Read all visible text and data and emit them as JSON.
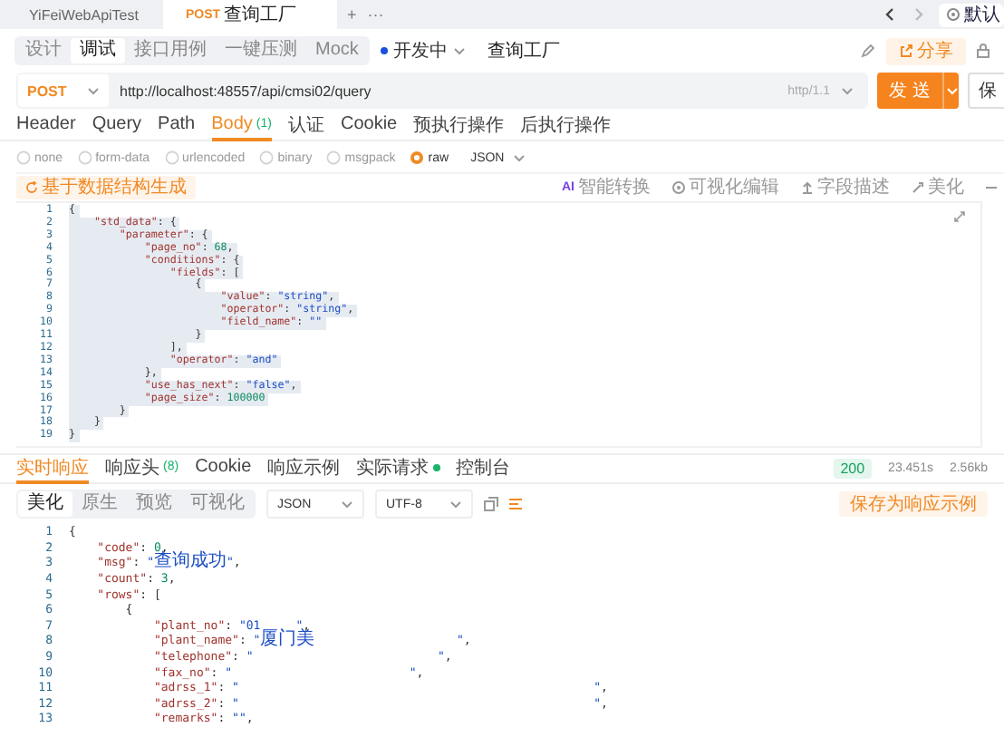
{
  "app_tabs": [
    {
      "label": "YiFeiWebApiTest",
      "selected": false
    },
    {
      "method": "POST",
      "label": "查询工厂",
      "selected": true
    }
  ],
  "app_tab_actions": [
    "+",
    "···"
  ],
  "environment": "默认",
  "mode_tabs": [
    {
      "label": "设计",
      "selected": false
    },
    {
      "label": "调试",
      "selected": true
    },
    {
      "label": "接口用例",
      "selected": false
    },
    {
      "label": "一键压测",
      "selected": false
    },
    {
      "label": "Mock",
      "selected": false
    }
  ],
  "status": "开发中",
  "api_name": "查询工厂",
  "share_button": "分享",
  "request": {
    "method": "POST",
    "url": "http://localhost:48557/api/cmsi02/query",
    "protocol": "http/1.1",
    "send_button": "发 送",
    "save_button": "保"
  },
  "request_tabs": [
    {
      "label": "Header",
      "selected": false
    },
    {
      "label": "Query",
      "selected": false
    },
    {
      "label": "Path",
      "selected": false
    },
    {
      "label": "Body",
      "count": "(1)",
      "selected": true
    },
    {
      "label": "认证",
      "selected": false
    },
    {
      "label": "Cookie",
      "selected": false
    },
    {
      "label": "预执行操作",
      "selected": false
    },
    {
      "label": "后执行操作",
      "selected": false
    }
  ],
  "body_types": [
    {
      "label": "none",
      "selected": false
    },
    {
      "label": "form-data",
      "selected": false
    },
    {
      "label": "urlencoded",
      "selected": false
    },
    {
      "label": "binary",
      "selected": false
    },
    {
      "label": "msgpack",
      "selected": false
    },
    {
      "label": "raw",
      "selected": true
    }
  ],
  "body_format": "JSON",
  "generate_button": "基于数据结构生成",
  "editor_tools": [
    {
      "kind": "ai",
      "badge": "AI",
      "label": "智能转换"
    },
    {
      "kind": "visual",
      "label": "可视化编辑"
    },
    {
      "kind": "describe",
      "label": "字段描述"
    },
    {
      "kind": "beautify",
      "label": "美化"
    }
  ],
  "request_body": {
    "selected": true,
    "lines": [
      {
        "no": "1",
        "code": "{"
      },
      {
        "no": "2",
        "code": "    \"std_data\": {"
      },
      {
        "no": "3",
        "code": "        \"parameter\": {"
      },
      {
        "no": "4",
        "code": "            \"page_no\": 68,"
      },
      {
        "no": "5",
        "code": "            \"conditions\": {"
      },
      {
        "no": "6",
        "code": "                \"fields\": ["
      },
      {
        "no": "7",
        "code": "                    {"
      },
      {
        "no": "8",
        "code": "                        \"value\": \"string\","
      },
      {
        "no": "9",
        "code": "                        \"operator\": \"string\","
      },
      {
        "no": "10",
        "code": "                        \"field_name\": \"\""
      },
      {
        "no": "11",
        "code": "                    }"
      },
      {
        "no": "12",
        "code": "                ],"
      },
      {
        "no": "13",
        "code": "                \"operator\": \"and\""
      },
      {
        "no": "14",
        "code": "            },"
      },
      {
        "no": "15",
        "code": "            \"use_has_next\": \"false\","
      },
      {
        "no": "16",
        "code": "            \"page_size\": 100000"
      },
      {
        "no": "17",
        "code": "        }"
      },
      {
        "no": "18",
        "code": "    }"
      },
      {
        "no": "19",
        "code": "}"
      }
    ]
  },
  "response_tabs": [
    {
      "label": "实时响应",
      "selected": true
    },
    {
      "label": "响应头",
      "count": "(8)",
      "selected": false
    },
    {
      "label": "Cookie",
      "selected": false
    },
    {
      "label": "响应示例",
      "selected": false
    },
    {
      "label": "实际请求",
      "dot": true,
      "selected": false
    },
    {
      "label": "控制台",
      "selected": false
    }
  ],
  "response_meta": {
    "status": "200",
    "time": "23.451s",
    "size": "2.56kb"
  },
  "view_modes": [
    {
      "label": "美化",
      "selected": true
    },
    {
      "label": "原生",
      "selected": false
    },
    {
      "label": "预览",
      "selected": false
    },
    {
      "label": "可视化",
      "selected": false
    }
  ],
  "response_format": "JSON",
  "encoding": "UTF-8",
  "save_example_button": "保存为响应示例",
  "response_body": {
    "lines": [
      {
        "no": "1",
        "code": "{"
      },
      {
        "no": "2",
        "code": "    \"code\": 0,"
      },
      {
        "no": "3",
        "code": "    \"msg\": \"查询成功\","
      },
      {
        "no": "4",
        "code": "    \"count\": 3,"
      },
      {
        "no": "5",
        "code": "    \"rows\": ["
      },
      {
        "no": "6",
        "code": "        {"
      },
      {
        "no": "7",
        "code": "            \"plant_no\": \"01     \","
      },
      {
        "no": "8",
        "code": "            \"plant_name\": \"厦门美                    \","
      },
      {
        "no": "9",
        "code": "            \"telephone\": \"                          \","
      },
      {
        "no": "10",
        "code": "            \"fax_no\": \"                         \","
      },
      {
        "no": "11",
        "code": "            \"adrss_1\": \"                                                  \","
      },
      {
        "no": "12",
        "code": "            \"adrss_2\": \"                                                  \","
      },
      {
        "no": "13",
        "code": "            \"remarks\": \"\","
      }
    ]
  }
}
